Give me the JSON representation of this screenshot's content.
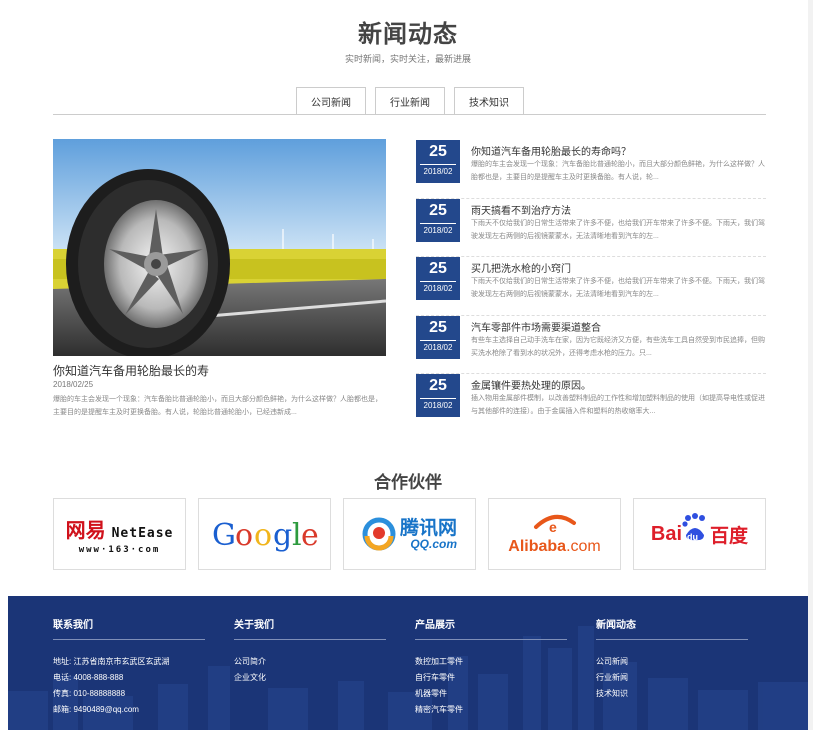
{
  "news": {
    "title": "新闻动态",
    "subtitle": "实时新闻，实时关注，最新进展",
    "tabs": [
      "公司新闻",
      "行业新闻",
      "技术知识"
    ]
  },
  "featured": {
    "image_icon": "tire-image",
    "title": "你知道汽车备用轮胎最长的寿",
    "date": "2018/02/25",
    "desc": "爆胎的车主会发现一个现象：汽车备胎比普通轮胎小，而且大部分颜色鲜艳，为什么这样做？人胎都也是，主要目的是提醒车主及时更换备胎。有人说，轮胎比普通轮胎小，已经违新成..."
  },
  "list": [
    {
      "day": "25",
      "ym": "2018/02",
      "title": "你知道汽车备用轮胎最长的寿命吗？",
      "desc": "爆胎的车主会发现一个现象：汽车备胎比普通轮胎小，而且大部分颜色鲜艳，为什么这样做？人胎都也是，主要目的是提醒车主及时更换备胎。有人说，轮..."
    },
    {
      "day": "25",
      "ym": "2018/02",
      "title": "雨天搞看不到治疗方法",
      "desc": "下雨天不仅给我们的日常生活带来了许多不便，也给我们开车带来了许多不便。下雨天，我们驾驶发现左右两侧的后视镜蒙蒙水，无法清晰地看到汽车的左..."
    },
    {
      "day": "25",
      "ym": "2018/02",
      "title": "买几把洗水枪的小窍门",
      "desc": "下雨天不仅给我们的日常生活带来了许多不便，也给我们开车带来了许多不便。下雨天，我们驾驶发现左右两侧的后视镜蒙蒙水，无法清晰地看到汽车的左..."
    },
    {
      "day": "25",
      "ym": "2018/02",
      "title": "汽车零部件市场需要渠道整合",
      "desc": "有些车主选择自己动手洗车在家，因为它既经济又方便，有些洗车工具自然受到市民追捧，但购买洗水枪除了看到水的状况外，还得考虑水枪的压力。只..."
    },
    {
      "day": "25",
      "ym": "2018/02",
      "title": "金属镶件要热处理的原因。",
      "desc": "插入物用金属部件模制，以改善塑料制品的工作性和增加塑料制品的使用（如提高导电性或促进与其他部件的连接）。由于金属插入件和塑料的热收缩率大..."
    }
  ],
  "partners": {
    "title": "合作伙伴",
    "logos": [
      {
        "name": "netease",
        "cn": "网易",
        "en": "NetEase",
        "url": "www·163·com"
      },
      {
        "name": "google",
        "text": "Google"
      },
      {
        "name": "tencent",
        "cn": "腾讯网",
        "url": "QQ.com"
      },
      {
        "name": "alibaba",
        "text": "Alibaba",
        "suffix": ".com"
      },
      {
        "name": "baidu",
        "left": "Bai",
        "mid": "du",
        "cn": "百度"
      }
    ]
  },
  "footer": {
    "contact": {
      "title": "联系我们",
      "items": [
        "地址: 江苏省南京市玄武区玄武湖",
        "电话: 4008-888-888",
        "传真: 010-88888888",
        "邮箱: 9490489@qq.com"
      ]
    },
    "about": {
      "title": "关于我们",
      "items": [
        "公司简介",
        "企业文化"
      ]
    },
    "products": {
      "title": "产品展示",
      "items": [
        "数控加工零件",
        "自行车零件",
        "机器零件",
        "精密汽车零件"
      ]
    },
    "newsLinks": {
      "title": "新闻动态",
      "items": [
        "公司新闻",
        "行业新闻",
        "技术知识"
      ]
    }
  },
  "colors": {
    "accent": "#23488c",
    "footer": "#1b3577"
  }
}
